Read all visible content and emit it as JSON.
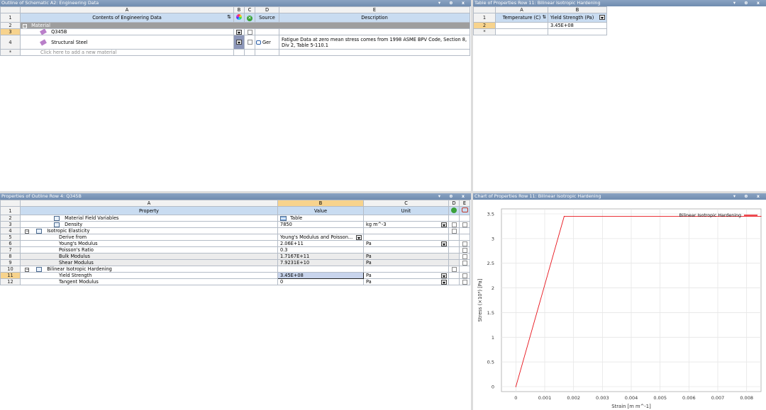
{
  "outline": {
    "title": "Outline of Schematic A2: Engineering Data",
    "controls": "▾ ⊕ x",
    "cols": [
      "A",
      "B",
      "C",
      "D",
      "E"
    ],
    "header": {
      "contents": "Contents of Engineering Data",
      "source": "Source",
      "description": "Description"
    },
    "rows": [
      {
        "num": "1"
      },
      {
        "num": "2",
        "label": "Material"
      },
      {
        "num": "3",
        "name": "Q345B"
      },
      {
        "num": "4",
        "name": "Structural Steel",
        "source": "Ger",
        "desc1": "Fatigue Data at zero mean stress comes from 1998 ASME BPV Code, Section 8,",
        "desc2": "Div 2, Table 5-110.1"
      },
      {
        "num": "*",
        "name": "Click here to add a new material"
      }
    ]
  },
  "table_props": {
    "title": "Table of Properties Row 11: Bilinear Isotropic Hardening",
    "controls": "▾ ⊕ x",
    "cols": [
      "A",
      "B"
    ],
    "header": [
      "Temperature (C)",
      "Yield Strength (Pa)"
    ],
    "rows": [
      {
        "num": "2",
        "a": "",
        "b": "3.45E+08"
      },
      {
        "num": "*",
        "a": "",
        "b": ""
      }
    ]
  },
  "properties": {
    "title": "Properties of Outline Row 4: Q345B",
    "controls": "▾ ⊕ x",
    "cols": [
      "A",
      "B",
      "C",
      "D",
      "E"
    ],
    "header": {
      "property": "Property",
      "value": "Value",
      "unit": "Unit"
    },
    "rows": [
      {
        "num": "2",
        "prop": "Material Field Variables",
        "value": "Table",
        "unit": ""
      },
      {
        "num": "3",
        "prop": "Density",
        "value": "7850",
        "unit": "kg m^-3"
      },
      {
        "num": "4",
        "prop": "Isotropic Elasticity",
        "value": "",
        "unit": ""
      },
      {
        "num": "5",
        "prop": "Derive from",
        "value": "Young's Modulus and Poisson...",
        "unit": ""
      },
      {
        "num": "6",
        "prop": "Young's Modulus",
        "value": "2.06E+11",
        "unit": "Pa"
      },
      {
        "num": "7",
        "prop": "Poisson's Ratio",
        "value": "0.3",
        "unit": ""
      },
      {
        "num": "8",
        "prop": "Bulk Modulus",
        "value": "1.7167E+11",
        "unit": "Pa"
      },
      {
        "num": "9",
        "prop": "Shear Modulus",
        "value": "7.9231E+10",
        "unit": "Pa"
      },
      {
        "num": "10",
        "prop": "Bilinear Isotropic Hardening",
        "value": "",
        "unit": ""
      },
      {
        "num": "11",
        "prop": "Yield Strength",
        "value": "3.45E+08",
        "unit": "Pa"
      },
      {
        "num": "12",
        "prop": "Tangent Modulus",
        "value": "0",
        "unit": "Pa"
      }
    ]
  },
  "chart_panel": {
    "title": "Chart of Properties Row 11: Bilinear Isotropic Hardening",
    "controls": "▾ ⊕ x"
  },
  "chart_data": {
    "type": "line",
    "xlabel": "Strain [m m^-1]",
    "ylabel": "Stress (×10⁸) [Pa]",
    "xlim": [
      -0.0005,
      0.0085
    ],
    "ylim": [
      -0.1,
      3.6
    ],
    "xticks": [
      "0",
      "0.001",
      "0.002",
      "0.003",
      "0.004",
      "0.005",
      "0.006",
      "0.007",
      "0.008"
    ],
    "xtickvals": [
      0,
      0.001,
      0.002,
      0.003,
      0.004,
      0.005,
      0.006,
      0.007,
      0.008
    ],
    "yticks": [
      "0",
      "0.5",
      "1",
      "1.5",
      "2",
      "2.5",
      "3",
      "3.5"
    ],
    "ytickvals": [
      0,
      0.5,
      1,
      1.5,
      2,
      2.5,
      3,
      3.5
    ],
    "grid": true,
    "legend_position": "top-right",
    "series": [
      {
        "name": "Bilinear Isotropic Hardening",
        "color": "#e8141c",
        "x": [
          0,
          0.001675,
          0.0085
        ],
        "y": [
          0,
          3.45,
          3.45
        ]
      }
    ]
  }
}
